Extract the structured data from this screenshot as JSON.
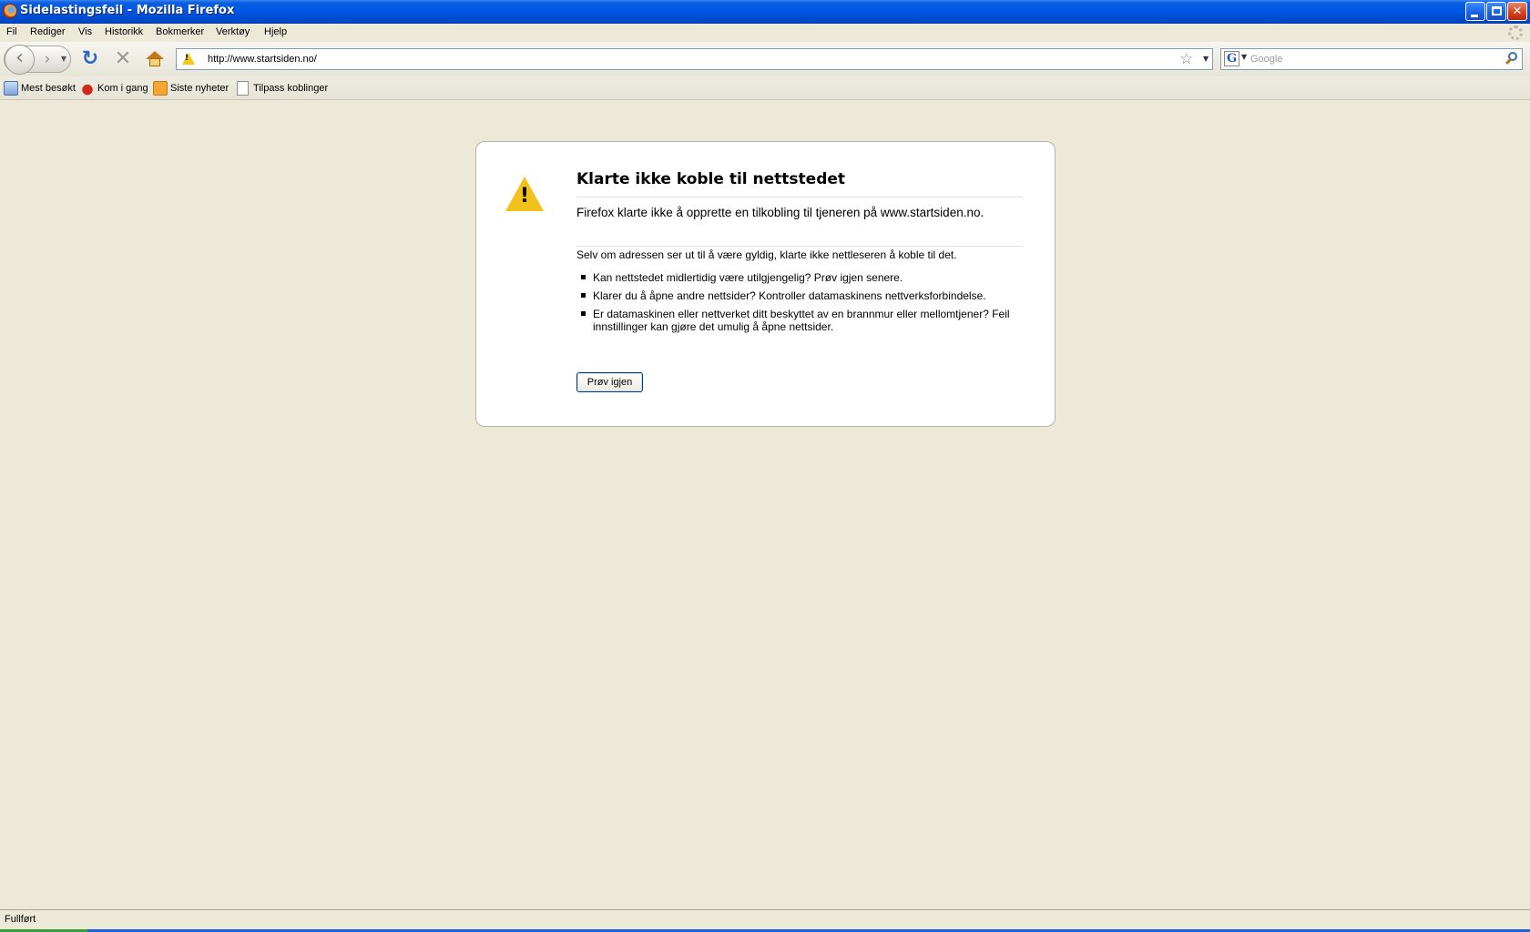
{
  "window": {
    "title": "Sidelastingsfeil - Mozilla Firefox",
    "controls": {
      "minimize": "minimize-icon",
      "maximize": "maximize-icon",
      "close": "close-icon"
    }
  },
  "menu": {
    "items": [
      "Fil",
      "Rediger",
      "Vis",
      "Historikk",
      "Bokmerker",
      "Verktøy",
      "Hjelp"
    ]
  },
  "navigation": {
    "url": "http://www.startsiden.no/",
    "search_placeholder": "Google",
    "icons": [
      "back-icon",
      "forward-icon",
      "reload-icon",
      "stop-icon",
      "home-icon",
      "bookmark-star-icon",
      "search-icon"
    ]
  },
  "bookmarks": {
    "items": [
      "Mest besøkt",
      "Kom i gang",
      "Siste nyheter",
      "Tilpass koblinger"
    ]
  },
  "error_page": {
    "title": "Klarte ikke koble til nettstedet",
    "short_desc": "Firefox klarte ikke å opprette en tilkobling til tjeneren på www.startsiden.no.",
    "intro": "Selv om adressen ser ut til å være gyldig, klarte ikke nettleseren å koble til det.",
    "bullets": [
      "Kan nettstedet midlertidig være utilgjengelig? Prøv igjen senere.",
      "Klarer du å åpne andre nettsider? Kontroller datamaskinens nettverksforbindelse.",
      "Er datamaskinen eller nettverket ditt beskyttet av en brannmur eller mellomtjener? Feil innstillinger kan gjøre det umulig å åpne nettsider."
    ],
    "retry_label": "Prøv igjen"
  },
  "status": {
    "text": "Fullført"
  },
  "colors": {
    "titlebar": "#0054e3",
    "chrome_background": "#ece9d8",
    "warning_yellow": "#f2c21a"
  }
}
